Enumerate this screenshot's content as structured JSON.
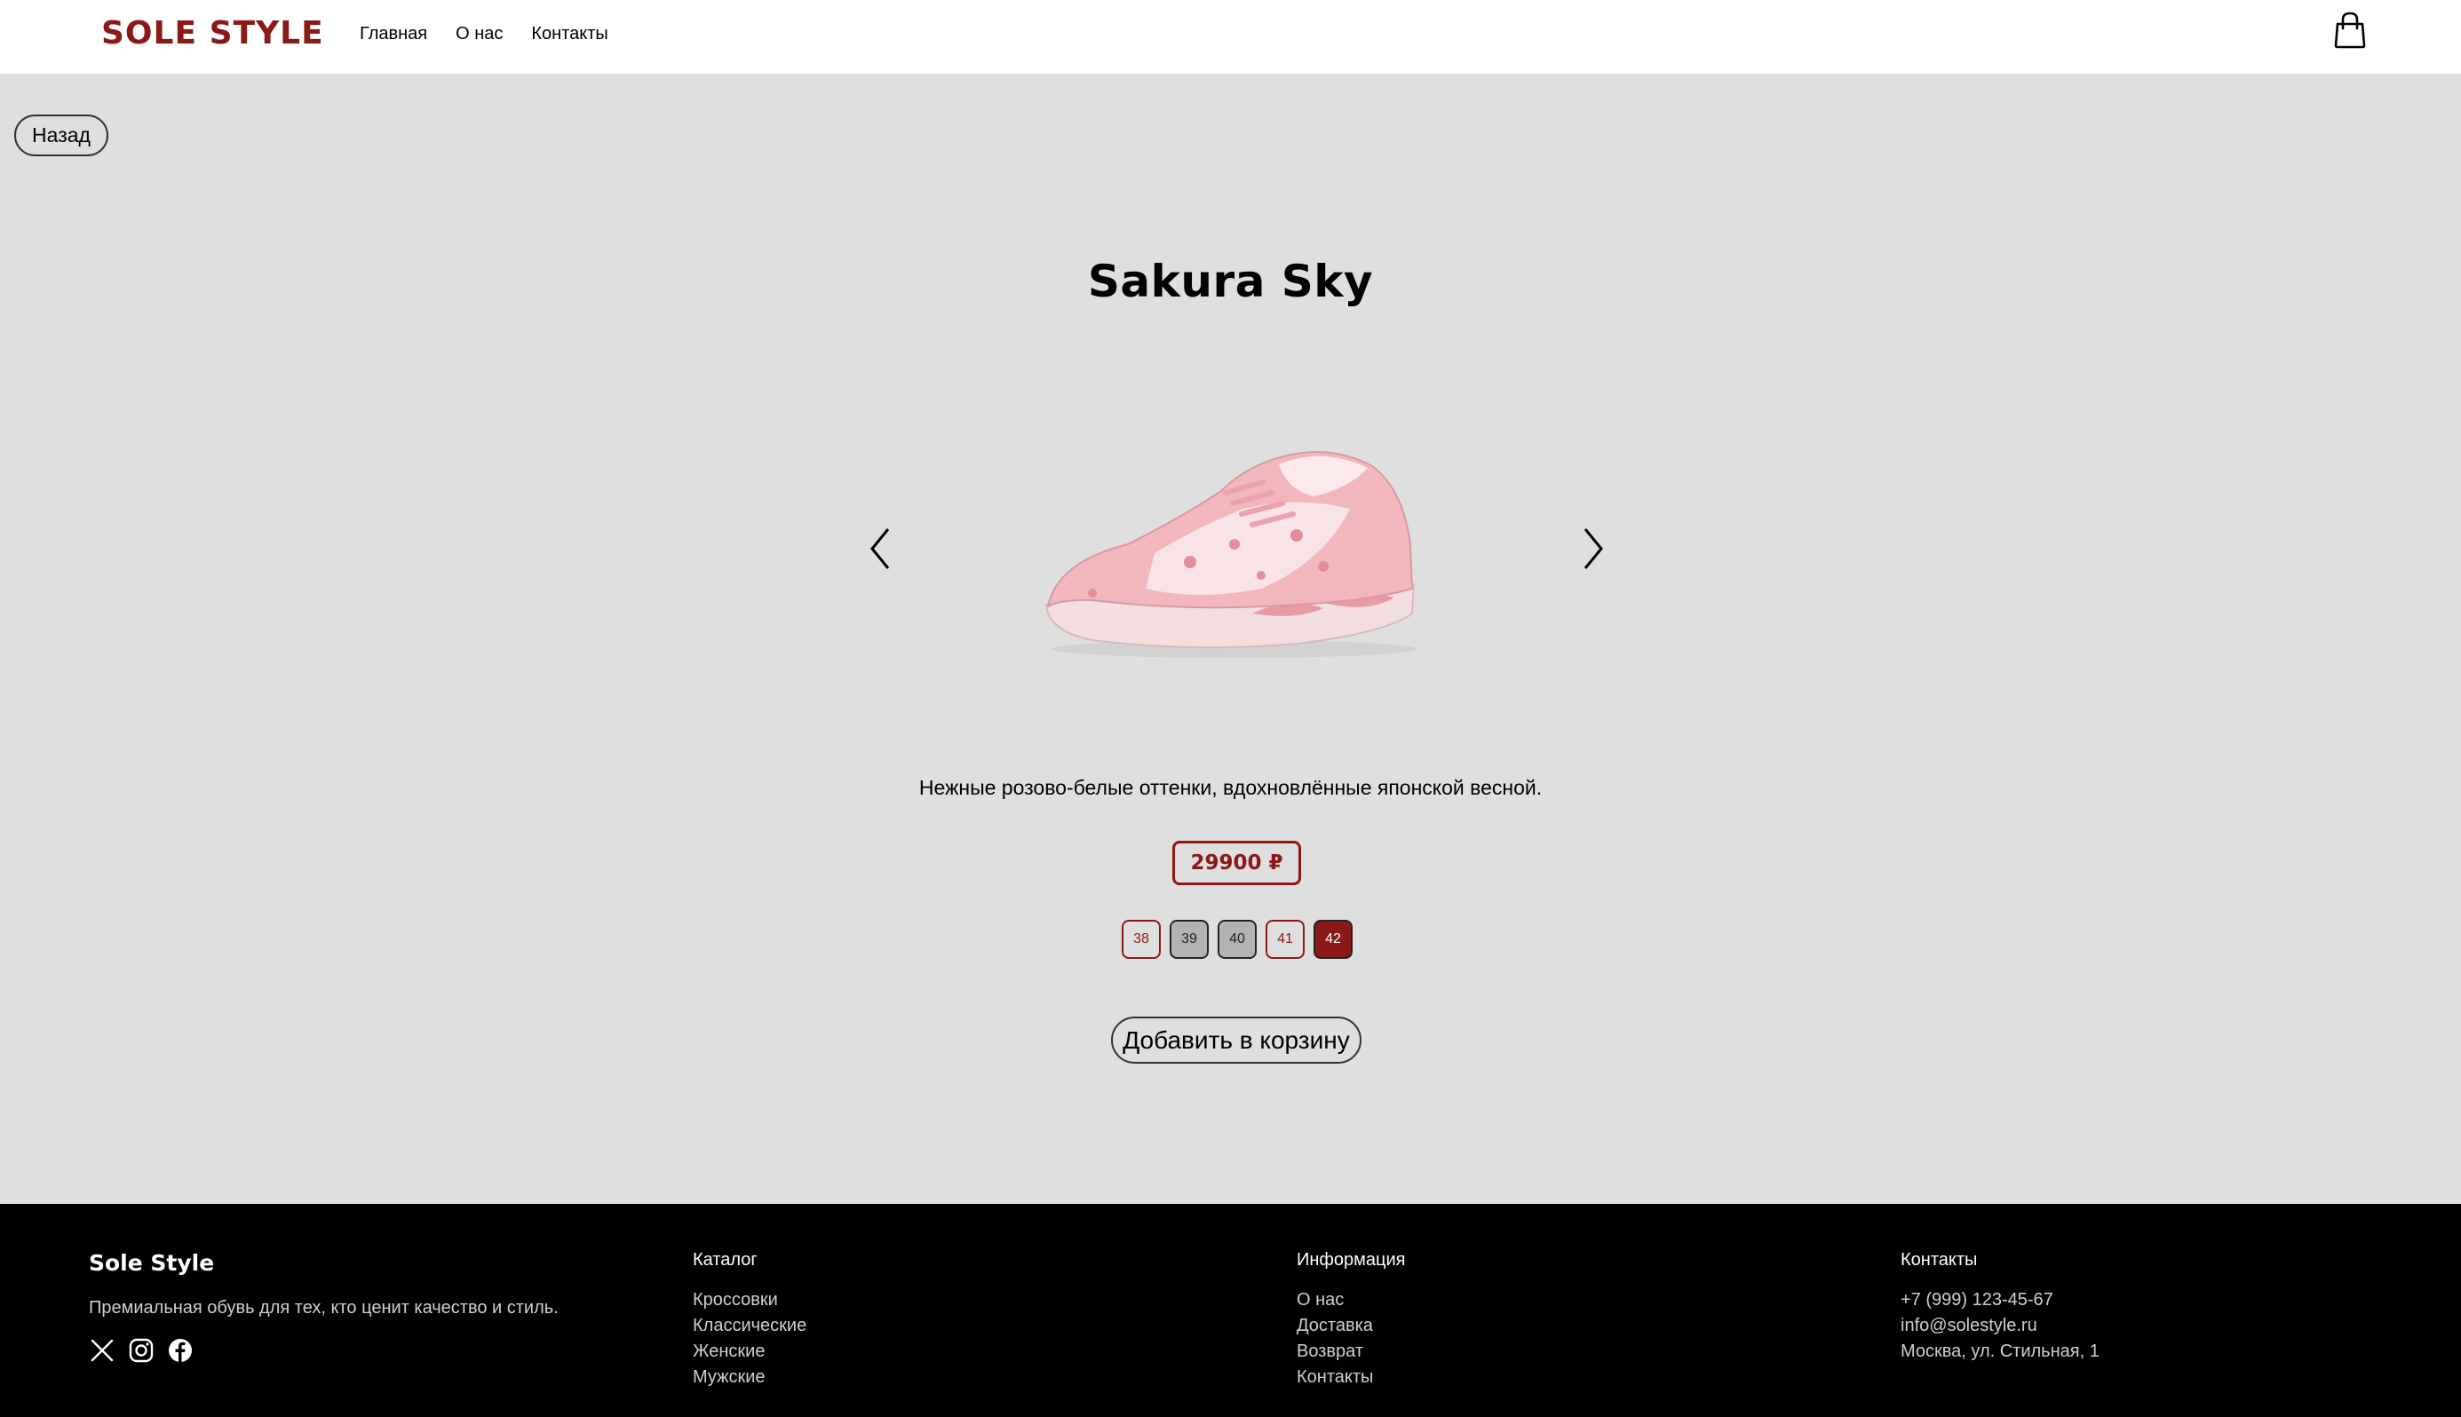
{
  "header": {
    "logo": "SOLE STYLE",
    "nav": [
      "Главная",
      "О нас",
      "Контакты"
    ],
    "colors": {
      "brand": "#8b1a17"
    }
  },
  "main": {
    "back_label": "Назад",
    "product": {
      "title": "Sakura Sky",
      "description": "Нежные розово-белые оттенки, вдохновлённые японской весной.",
      "price": "29900 ₽",
      "sizes": [
        {
          "label": "38",
          "state": "available"
        },
        {
          "label": "39",
          "state": "unavailable"
        },
        {
          "label": "40",
          "state": "unavailable"
        },
        {
          "label": "41",
          "state": "available"
        },
        {
          "label": "42",
          "state": "selected"
        }
      ],
      "add_to_cart_label": "Добавить в корзину"
    }
  },
  "footer": {
    "brand": "Sole Style",
    "tagline": "Премиальная обувь для тех, кто ценит качество и стиль.",
    "socials": [
      "x-icon",
      "instagram-icon",
      "facebook-icon"
    ],
    "catalog": {
      "title": "Каталог",
      "items": [
        "Кроссовки",
        "Классические",
        "Женские",
        "Мужские"
      ]
    },
    "info": {
      "title": "Информация",
      "items": [
        "О нас",
        "Доставка",
        "Возврат",
        "Контакты"
      ]
    },
    "contacts": {
      "title": "Контакты",
      "items": [
        "+7 (999) 123-45-67",
        "info@solestyle.ru",
        "Москва, ул. Стильная, 1"
      ]
    }
  }
}
